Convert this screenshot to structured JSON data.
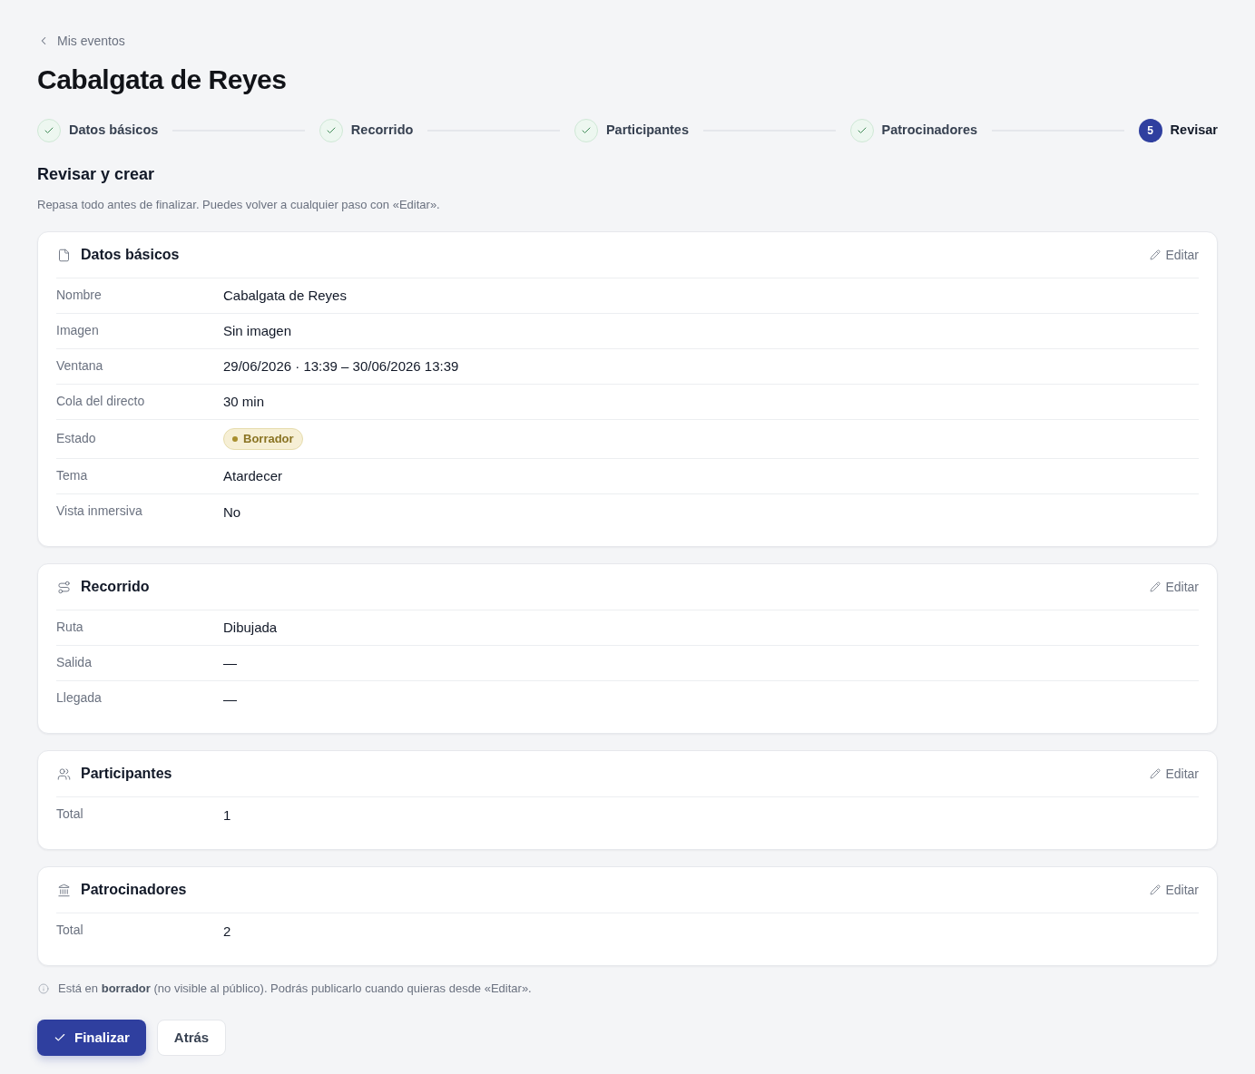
{
  "breadcrumb": {
    "label": "Mis eventos"
  },
  "title": "Cabalgata de Reyes",
  "steps": [
    {
      "label": "Datos básicos",
      "completed": true
    },
    {
      "label": "Recorrido",
      "completed": true
    },
    {
      "label": "Participantes",
      "completed": true
    },
    {
      "label": "Patrocinadores",
      "completed": true
    },
    {
      "label": "Revisar",
      "completed": false,
      "number": "5"
    }
  ],
  "heading": "Revisar y crear",
  "subtitle": "Repasa todo antes de finalizar. Puedes volver a cualquier paso con «Editar».",
  "sections": [
    {
      "title": "Datos básicos",
      "edit_label": "Editar",
      "rows": [
        {
          "label": "Nombre",
          "value": "Cabalgata de Reyes",
          "kind": "text"
        },
        {
          "label": "Imagen",
          "value": "Sin imagen",
          "kind": "text"
        },
        {
          "label": "Ventana",
          "value": "29/06/2026 · 13:39 – 30/06/2026 13:39",
          "kind": "text"
        },
        {
          "label": "Cola del directo",
          "value": "30 min",
          "kind": "text"
        },
        {
          "label": "Estado",
          "value": "Borrador",
          "kind": "badge"
        },
        {
          "label": "Tema",
          "value": "Atardecer",
          "kind": "text"
        },
        {
          "label": "Vista inmersiva",
          "value": "No",
          "kind": "text"
        }
      ]
    },
    {
      "title": "Recorrido",
      "edit_label": "Editar",
      "rows": [
        {
          "label": "Ruta",
          "value": "Dibujada",
          "kind": "text"
        },
        {
          "label": "Salida",
          "value": "—",
          "kind": "text"
        },
        {
          "label": "Llegada",
          "value": "—",
          "kind": "text"
        }
      ]
    },
    {
      "title": "Participantes",
      "edit_label": "Editar",
      "rows": [
        {
          "label": "Total",
          "value": "1",
          "kind": "text"
        }
      ]
    },
    {
      "title": "Patrocinadores",
      "edit_label": "Editar",
      "rows": [
        {
          "label": "Total",
          "value": "2",
          "kind": "text"
        }
      ]
    }
  ],
  "note": "Está en **borrador** (no visible al público). Podrás publicarlo cuando quieras desde «Editar».",
  "actions": [
    {
      "label": "Finalizar",
      "kind": "primary"
    },
    {
      "label": "Atrás",
      "kind": "secondary"
    }
  ]
}
